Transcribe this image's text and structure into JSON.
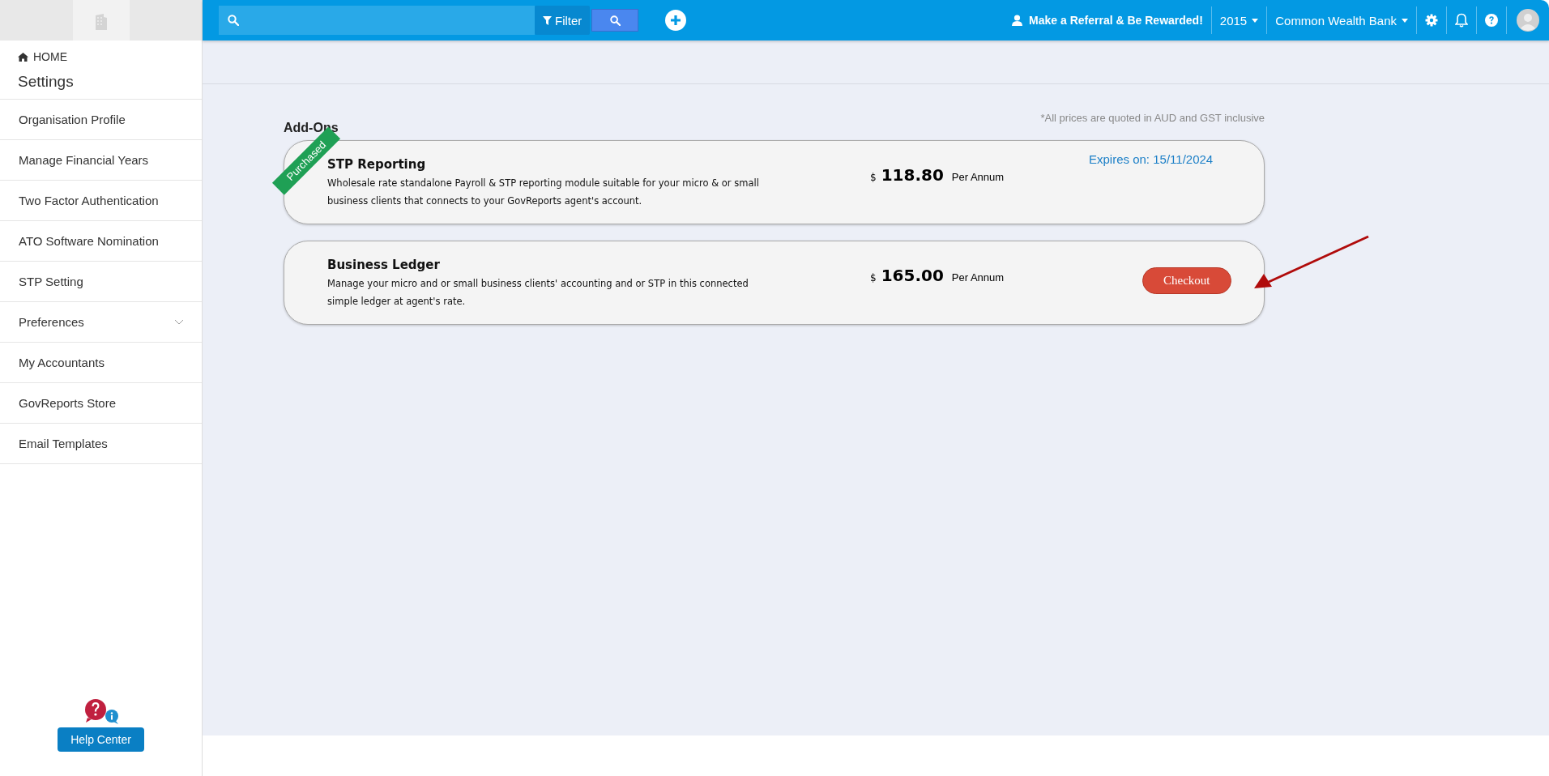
{
  "topbar": {
    "filter_label": "Filter",
    "referral": "Make a Referral & Be Rewarded!",
    "year": "2015",
    "company": "Common Wealth Bank"
  },
  "sidebar": {
    "home": "HOME",
    "title": "Settings",
    "items": [
      {
        "label": "Organisation Profile",
        "kind": "link"
      },
      {
        "label": "Manage Financial Years",
        "kind": "link"
      },
      {
        "label": "Two Factor Authentication",
        "kind": "link"
      },
      {
        "label": "ATO Software Nomination",
        "kind": "link"
      },
      {
        "label": "STP Setting",
        "kind": "link"
      },
      {
        "label": "Preferences",
        "kind": "group"
      },
      {
        "label": "My Accountants",
        "kind": "link"
      },
      {
        "label": "GovReports Store",
        "kind": "link"
      },
      {
        "label": "Email Templates",
        "kind": "link"
      }
    ],
    "help_label": "Help Center"
  },
  "addons": {
    "title": "Add-Ons",
    "note": "*All prices are quoted in AUD and GST inclusive",
    "items": [
      {
        "name": "STP Reporting",
        "description": "Wholesale rate standalone Payroll & STP reporting module suitable for your micro & or small business clients that connects to your GovReports agent's account.",
        "currency": "$",
        "price": "118.80",
        "period": "Per Annum",
        "purchased": true,
        "ribbon": "Purchased",
        "expires": "Expires on: 15/11/2024"
      },
      {
        "name": "Business Ledger",
        "description": "Manage your micro and or small business clients' accounting and or STP in this connected simple ledger at agent's rate.",
        "currency": "$",
        "price": "165.00",
        "period": "Per Annum",
        "purchased": false,
        "action": "Checkout"
      }
    ]
  }
}
